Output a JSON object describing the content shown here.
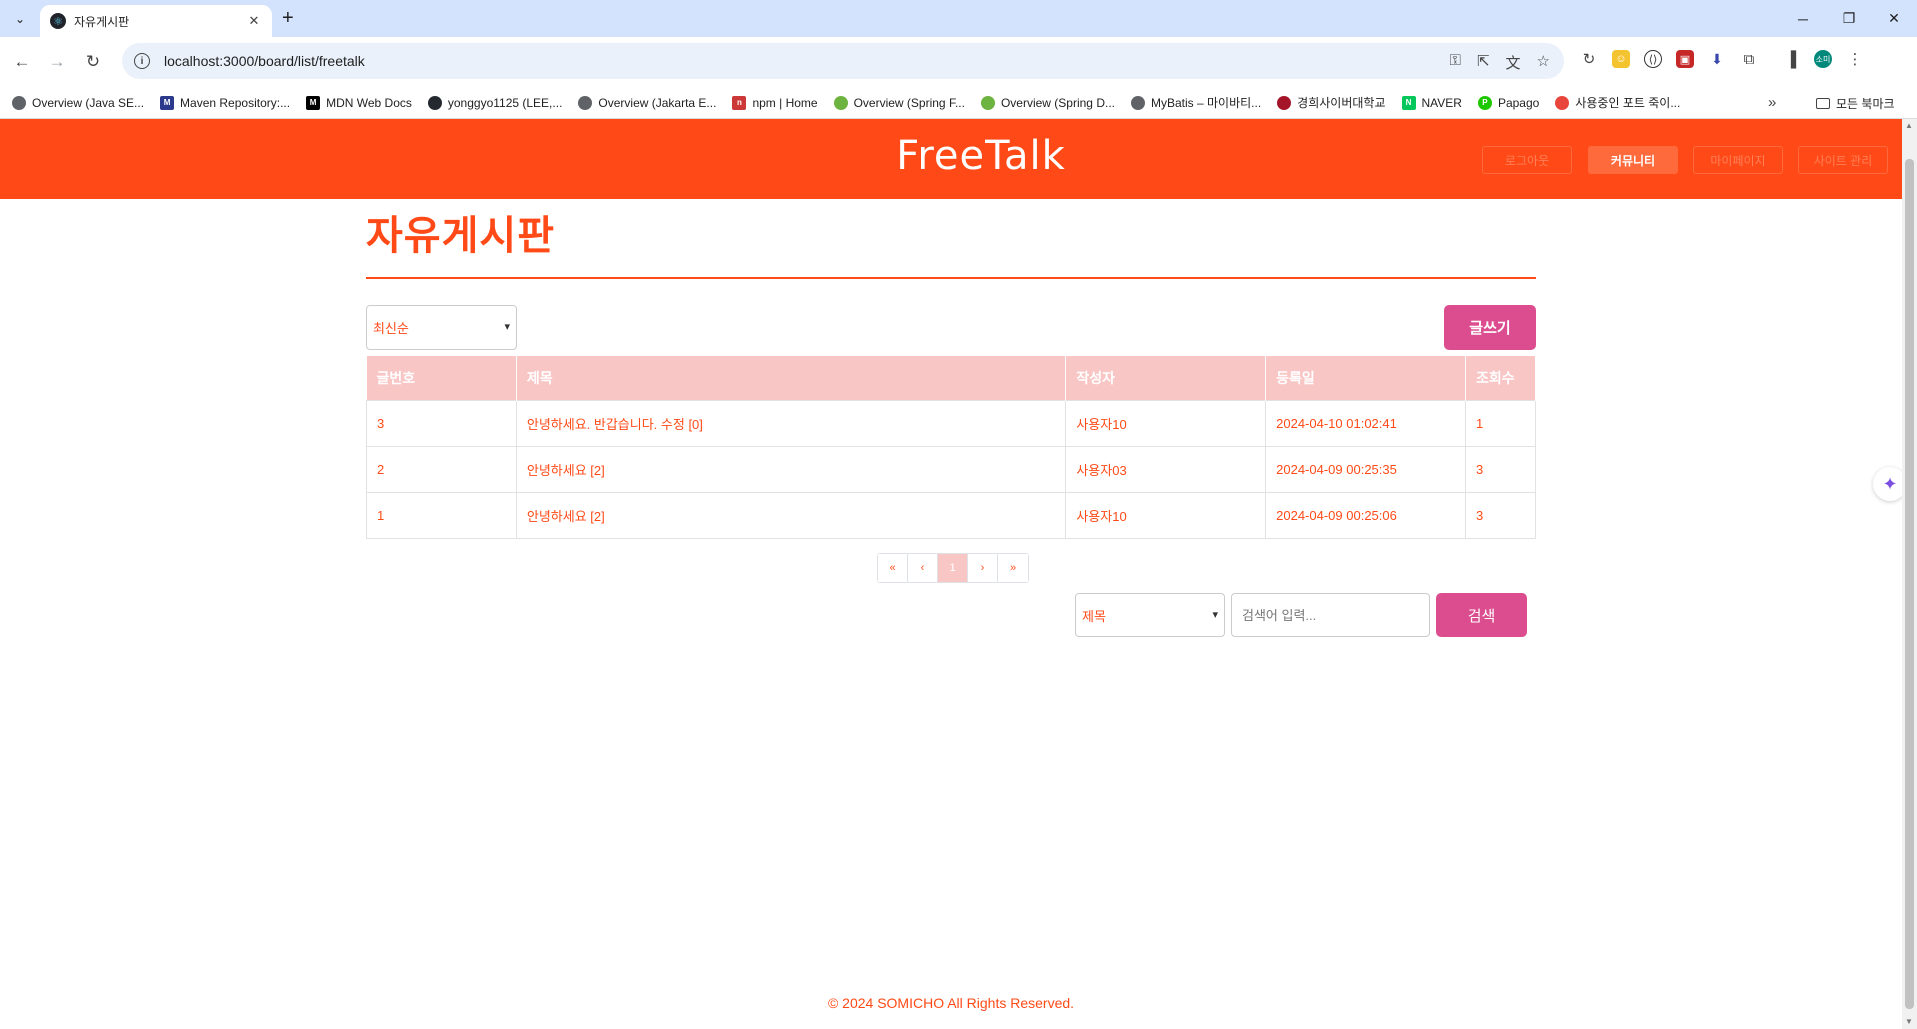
{
  "browser": {
    "tab_title": "자유게시판",
    "url": "localhost:3000/board/list/freetalk",
    "bookmarks": [
      {
        "label": "Overview (Java SE...",
        "color": "#5f6368"
      },
      {
        "label": "Maven Repository:...",
        "color": "#2b3a8c"
      },
      {
        "label": "MDN Web Docs",
        "color": "#000000"
      },
      {
        "label": "yonggyo1125 (LEE,...",
        "color": "#24292f"
      },
      {
        "label": "Overview (Jakarta E...",
        "color": "#5f6368"
      },
      {
        "label": "npm | Home",
        "color": "#cb3837"
      },
      {
        "label": "Overview (Spring F...",
        "color": "#6db33f"
      },
      {
        "label": "Overview (Spring D...",
        "color": "#6db33f"
      },
      {
        "label": "MyBatis – 마이바티...",
        "color": "#5f6368"
      },
      {
        "label": "경희사이버대학교",
        "color": "#a5152a"
      },
      {
        "label": "NAVER",
        "color": "#03c75a"
      },
      {
        "label": "Papago",
        "color": "#1ec800"
      },
      {
        "label": "사용중인 포트 죽이...",
        "color": "#e8453c"
      }
    ],
    "bookmarks_folder": "모든 북마크",
    "profile_initial": "소미"
  },
  "site": {
    "logo": "FreeTalk",
    "nav": [
      {
        "label": "로그아웃",
        "active": false
      },
      {
        "label": "커뮤니티",
        "active": true
      },
      {
        "label": "마이페이지",
        "active": false
      },
      {
        "label": "사이트 관리",
        "active": false
      }
    ]
  },
  "board": {
    "title": "자유게시판",
    "sort_selected": "최신순",
    "write_label": "글쓰기",
    "columns": [
      "글번호",
      "제목",
      "작성자",
      "등록일",
      "조회수"
    ],
    "rows": [
      {
        "no": "3",
        "title": "안녕하세요. 반갑습니다. 수정 [0]",
        "writer": "사용자10",
        "date": "2024-04-10 01:02:41",
        "views": "1"
      },
      {
        "no": "2",
        "title": "안녕하세요 [2]",
        "writer": "사용자03",
        "date": "2024-04-09 00:25:35",
        "views": "3"
      },
      {
        "no": "1",
        "title": "안녕하세요 [2]",
        "writer": "사용자10",
        "date": "2024-04-09 00:25:06",
        "views": "3"
      }
    ],
    "pagination": {
      "first": "«",
      "prev": "‹",
      "current": "1",
      "next": "›",
      "last": "»"
    },
    "search": {
      "type_selected": "제목",
      "placeholder": "검색어 입력...",
      "button": "검색"
    }
  },
  "footer": "© 2024 SOMICHO All Rights Reserved."
}
